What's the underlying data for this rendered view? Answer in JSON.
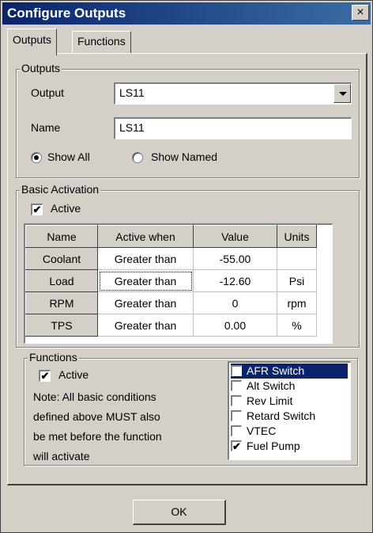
{
  "window": {
    "title": "Configure Outputs",
    "close_glyph": "×"
  },
  "tabs": [
    {
      "label": "Outputs",
      "active": true
    },
    {
      "label": "Functions",
      "active": false
    }
  ],
  "outputs_group": {
    "legend": "Outputs",
    "output_label": "Output",
    "output_value": "LS11",
    "name_label": "Name",
    "name_value": "LS11",
    "show_all_label": "Show All",
    "show_named_label": "Show Named",
    "selected_filter": "Show All"
  },
  "basic_activation": {
    "legend": "Basic Activation",
    "active_label": "Active",
    "active_checked": true,
    "columns": [
      "Name",
      "Active when",
      "Value",
      "Units"
    ],
    "rows": [
      {
        "name": "Coolant",
        "active_when": "Greater than",
        "value": "-55.00",
        "units": ""
      },
      {
        "name": "Load",
        "active_when": "Greater than",
        "value": "-12.60",
        "units": "Psi"
      },
      {
        "name": "RPM",
        "active_when": "Greater than",
        "value": "0",
        "units": "rpm"
      },
      {
        "name": "TPS",
        "active_when": "Greater than",
        "value": "0.00",
        "units": "%"
      }
    ]
  },
  "functions_group": {
    "legend": "Functions",
    "active_label": "Active",
    "active_checked": true,
    "note_lines": [
      "Note: All basic conditions",
      "defined above MUST also",
      "be met before the function",
      "will activate"
    ],
    "list": [
      {
        "label": "AFR Switch",
        "checked": false,
        "selected": true
      },
      {
        "label": "Alt Switch",
        "checked": false,
        "selected": false
      },
      {
        "label": "Rev Limit",
        "checked": false,
        "selected": false
      },
      {
        "label": "Retard Switch",
        "checked": false,
        "selected": false
      },
      {
        "label": "VTEC",
        "checked": false,
        "selected": false
      },
      {
        "label": "Fuel Pump",
        "checked": true,
        "selected": false
      }
    ]
  },
  "buttons": {
    "ok_label": "OK"
  },
  "icons": {
    "check_glyph": "✔"
  }
}
